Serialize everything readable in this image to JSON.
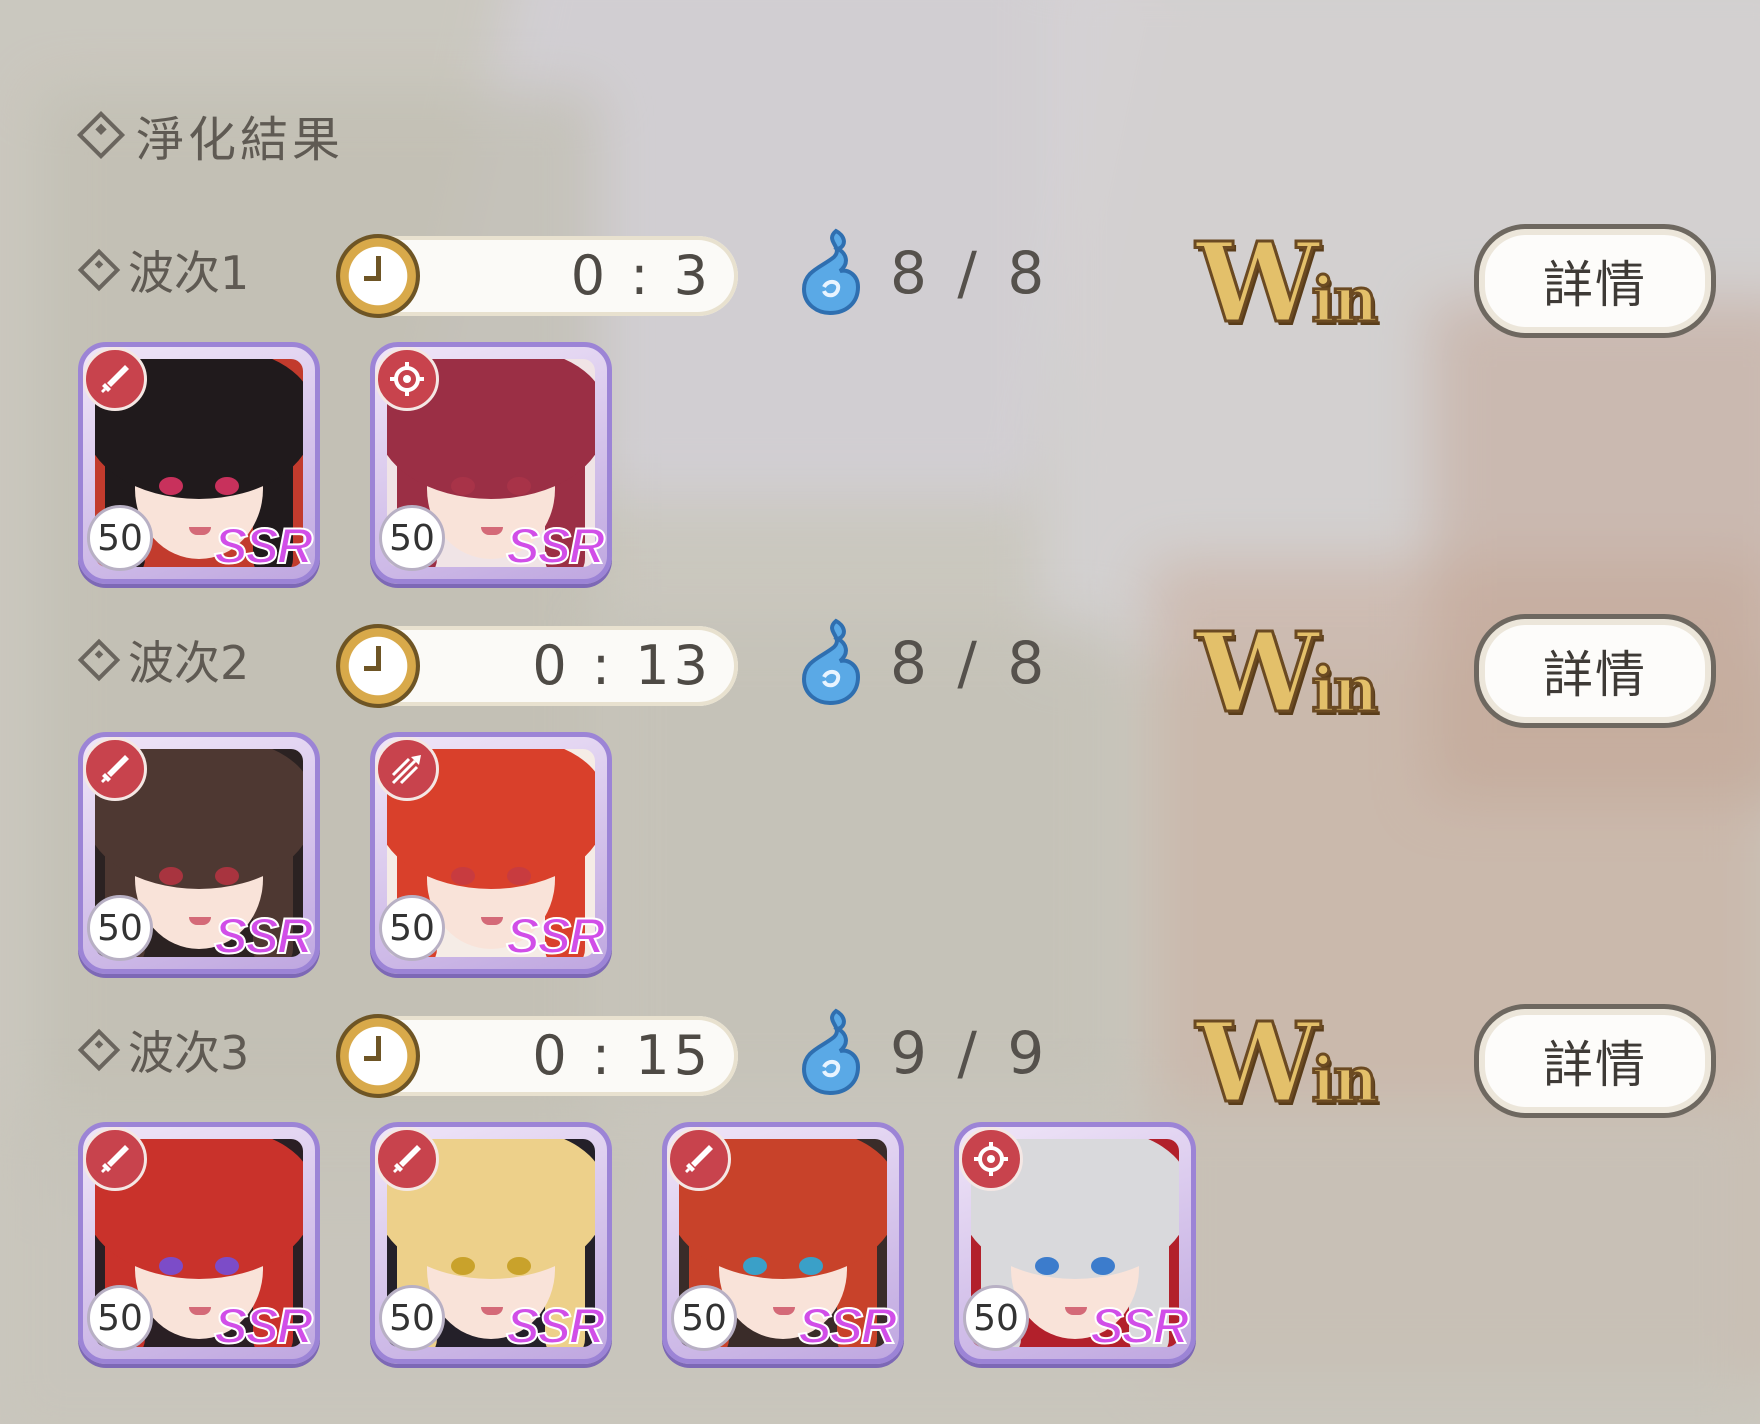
{
  "title": "淨化結果",
  "details_label": "詳情",
  "win_label": {
    "big": "W",
    "small": "in"
  },
  "colors": {
    "rarity": "#d14ee8",
    "frame": "#9c84d6",
    "role_bg": "#c8434d",
    "energy": "#5aa9e6",
    "win": "#e3c06a"
  },
  "waves": [
    {
      "label": "波次1",
      "time": "0 : 3",
      "energy": "8 / 8",
      "result": "Win",
      "units": [
        {
          "role_icon": "sword-icon",
          "level": "50",
          "rarity": "SSR",
          "hair": "#201a1c",
          "eye": "#c8315c",
          "accent": "#c23b2d"
        },
        {
          "role_icon": "crosshair-icon",
          "level": "50",
          "rarity": "SSR",
          "hair": "#9b2f45",
          "eye": "#a83348",
          "accent": "#f0e4e6"
        }
      ]
    },
    {
      "label": "波次2",
      "time": "0 : 13",
      "energy": "8 / 8",
      "result": "Win",
      "units": [
        {
          "role_icon": "sword-icon",
          "level": "50",
          "rarity": "SSR",
          "hair": "#4e3832",
          "eye": "#a8343f",
          "accent": "#2b2222"
        },
        {
          "role_icon": "triple-arrow-icon",
          "level": "50",
          "rarity": "SSR",
          "hair": "#d9402b",
          "eye": "#c83b3f",
          "accent": "#f5ece6"
        }
      ]
    },
    {
      "label": "波次3",
      "time": "0 : 15",
      "energy": "9 / 9",
      "result": "Win",
      "units": [
        {
          "role_icon": "sword-icon",
          "level": "50",
          "rarity": "SSR",
          "hair": "#c9322b",
          "eye": "#7c4cc8",
          "accent": "#2a1f24"
        },
        {
          "role_icon": "sword-icon",
          "level": "50",
          "rarity": "SSR",
          "hair": "#edd08a",
          "eye": "#c9a22b",
          "accent": "#242029"
        },
        {
          "role_icon": "sword-icon",
          "level": "50",
          "rarity": "SSR",
          "hair": "#c8422a",
          "eye": "#3aa0c8",
          "accent": "#3a2c29"
        },
        {
          "role_icon": "crosshair-icon",
          "level": "50",
          "rarity": "SSR",
          "hair": "#d9d9dc",
          "eye": "#3c7ccc",
          "accent": "#b2202b"
        }
      ]
    }
  ]
}
